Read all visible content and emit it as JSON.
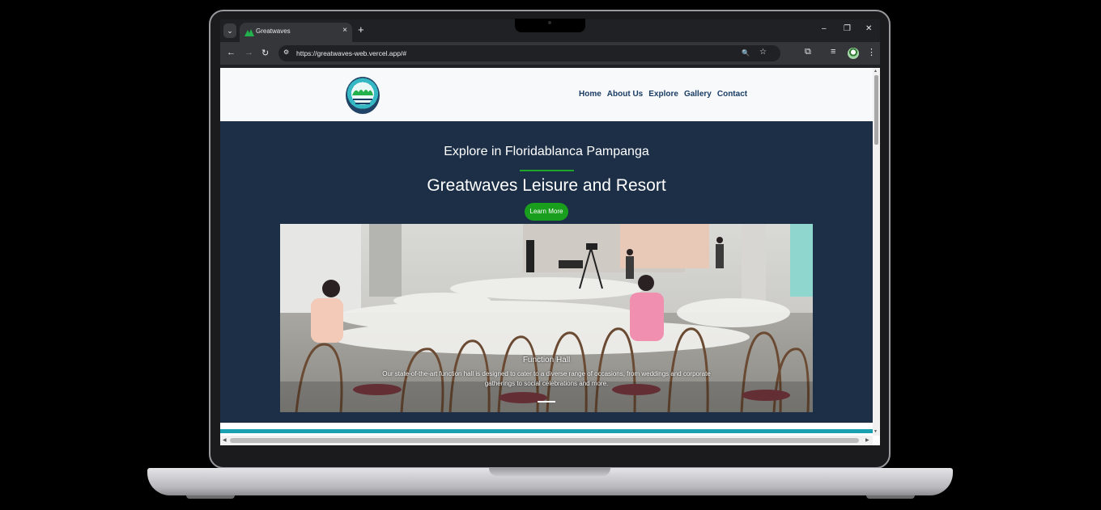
{
  "browser": {
    "tab_title": "Greatwaves",
    "tab_close": "×",
    "new_tab": "+",
    "url": "https://greatwaves-web.vercel.app/#",
    "icons": {
      "tab_search": "⌄",
      "back": "←",
      "forward": "→",
      "reload": "↻",
      "site_info": "⚙",
      "zoom": "🔍",
      "bookmark": "☆",
      "extensions": "⧉",
      "media": "≡",
      "menu": "⋮",
      "minimize": "–",
      "restore": "❐",
      "close": "✕"
    }
  },
  "site": {
    "nav": [
      "Home",
      "About Us",
      "Explore",
      "Gallery",
      "Contact"
    ],
    "hero": {
      "subtitle": "Explore in Floridablanca Pampanga",
      "title": "Greatwaves Leisure and Resort",
      "button": "Learn More"
    },
    "carousel": {
      "caption_title": "Function Hall",
      "caption_text": "Our state-of-the-art function hall is designed to cater to a diverse range of occasions, from weddings and corporate gatherings to social celebrations and more."
    }
  },
  "colors": {
    "hero_bg": "#1c2f47",
    "accent_green": "#1a9e1d",
    "nav_text": "#1b3c63",
    "teal": "#1aa0b0"
  }
}
